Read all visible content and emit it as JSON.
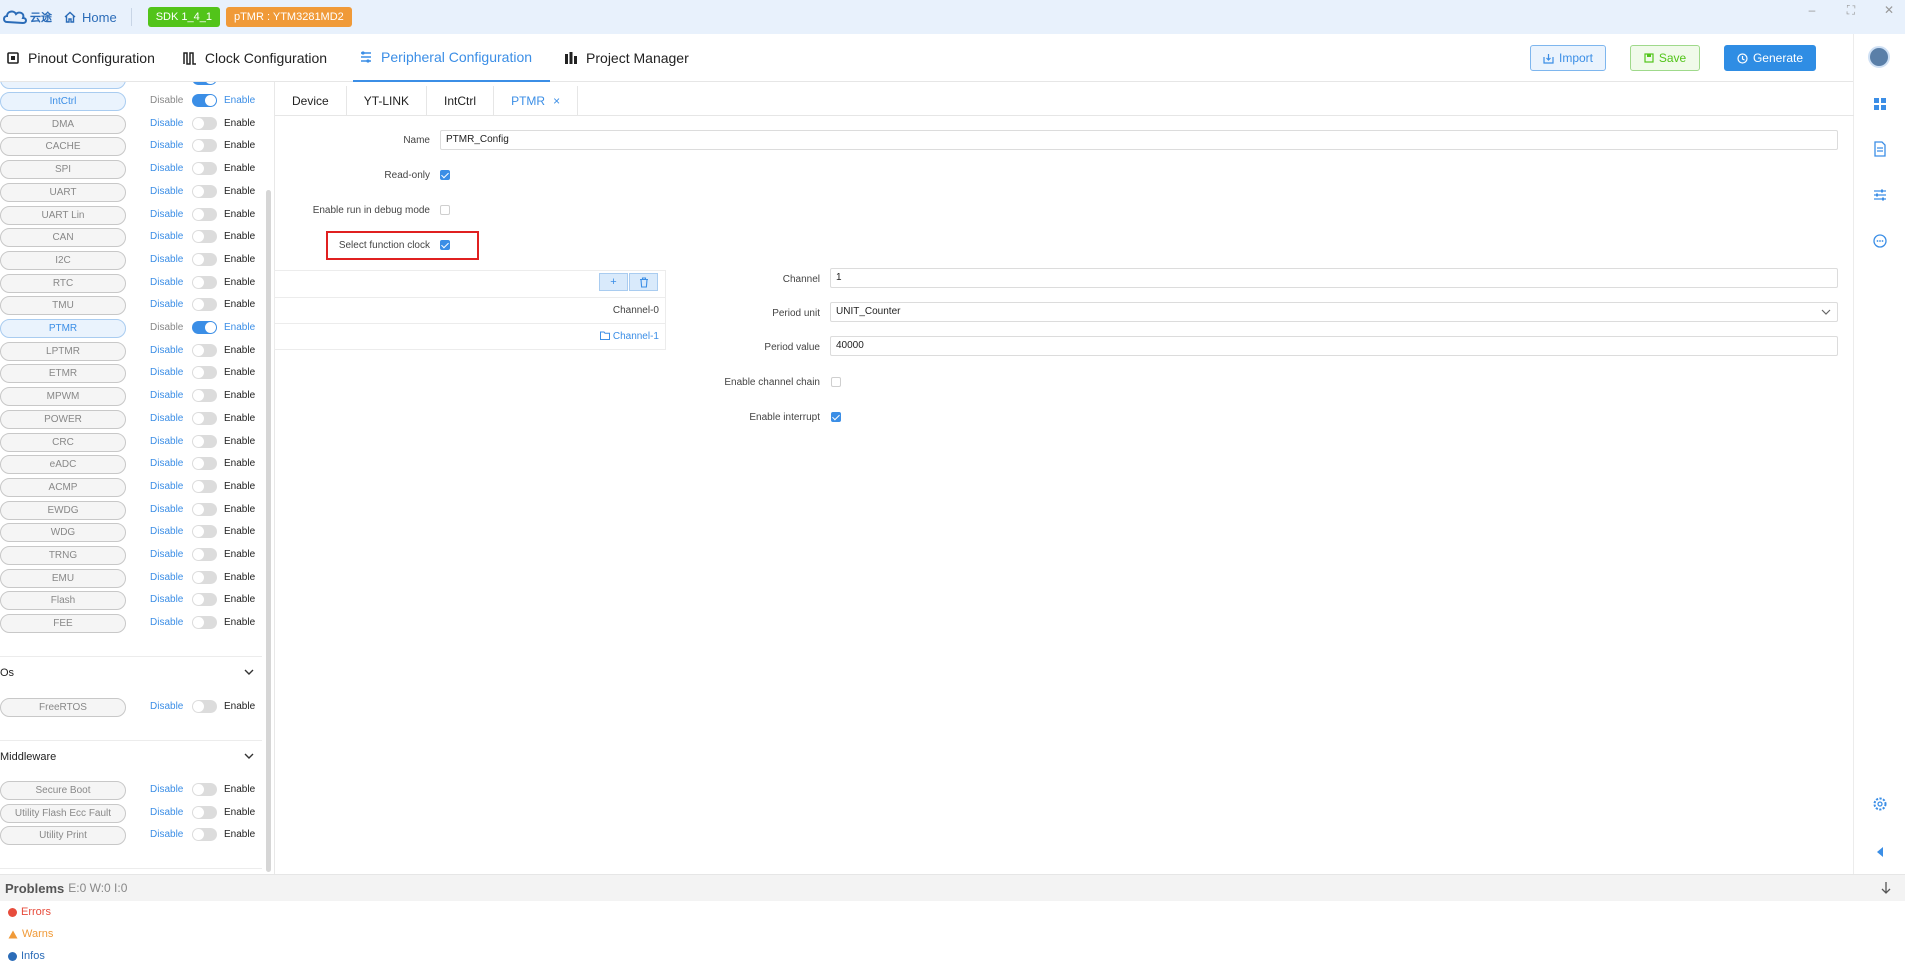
{
  "titlebar": {
    "logo_text": "云途",
    "home_label": "Home",
    "sdk_badge": "SDK 1_4_1",
    "device_badge": "pTMR : YTM3281MD2"
  },
  "nav": {
    "items": [
      {
        "label": "Pinout Configuration"
      },
      {
        "label": "Clock Configuration"
      },
      {
        "label": "Peripheral Configuration"
      },
      {
        "label": "Project Manager"
      }
    ],
    "import_label": "Import",
    "save_label": "Save",
    "generate_label": "Generate"
  },
  "peripherals": [
    {
      "name": "IntCtrl",
      "disable": "Disable",
      "enable": "Enable",
      "enabled": true
    },
    {
      "name": "DMA",
      "disable": "Disable",
      "enable": "Enable",
      "enabled": false
    },
    {
      "name": "CACHE",
      "disable": "Disable",
      "enable": "Enable",
      "enabled": false
    },
    {
      "name": "SPI",
      "disable": "Disable",
      "enable": "Enable",
      "enabled": false
    },
    {
      "name": "UART",
      "disable": "Disable",
      "enable": "Enable",
      "enabled": false
    },
    {
      "name": "UART Lin",
      "disable": "Disable",
      "enable": "Enable",
      "enabled": false
    },
    {
      "name": "CAN",
      "disable": "Disable",
      "enable": "Enable",
      "enabled": false
    },
    {
      "name": "I2C",
      "disable": "Disable",
      "enable": "Enable",
      "enabled": false
    },
    {
      "name": "RTC",
      "disable": "Disable",
      "enable": "Enable",
      "enabled": false
    },
    {
      "name": "TMU",
      "disable": "Disable",
      "enable": "Enable",
      "enabled": false
    },
    {
      "name": "PTMR",
      "disable": "Disable",
      "enable": "Enable",
      "enabled": true
    },
    {
      "name": "LPTMR",
      "disable": "Disable",
      "enable": "Enable",
      "enabled": false
    },
    {
      "name": "ETMR",
      "disable": "Disable",
      "enable": "Enable",
      "enabled": false
    },
    {
      "name": "MPWM",
      "disable": "Disable",
      "enable": "Enable",
      "enabled": false
    },
    {
      "name": "POWER",
      "disable": "Disable",
      "enable": "Enable",
      "enabled": false
    },
    {
      "name": "CRC",
      "disable": "Disable",
      "enable": "Enable",
      "enabled": false
    },
    {
      "name": "eADC",
      "disable": "Disable",
      "enable": "Enable",
      "enabled": false
    },
    {
      "name": "ACMP",
      "disable": "Disable",
      "enable": "Enable",
      "enabled": false
    },
    {
      "name": "EWDG",
      "disable": "Disable",
      "enable": "Enable",
      "enabled": false
    },
    {
      "name": "WDG",
      "disable": "Disable",
      "enable": "Enable",
      "enabled": false
    },
    {
      "name": "TRNG",
      "disable": "Disable",
      "enable": "Enable",
      "enabled": false
    },
    {
      "name": "EMU",
      "disable": "Disable",
      "enable": "Enable",
      "enabled": false
    },
    {
      "name": "Flash",
      "disable": "Disable",
      "enable": "Enable",
      "enabled": false
    },
    {
      "name": "FEE",
      "disable": "Disable",
      "enable": "Enable",
      "enabled": false
    }
  ],
  "os_section": {
    "title": "Os",
    "items": [
      {
        "name": "FreeRTOS",
        "disable": "Disable",
        "enable": "Enable",
        "enabled": false
      }
    ]
  },
  "middleware_section": {
    "title": "Middleware",
    "items": [
      {
        "name": "Secure Boot",
        "disable": "Disable",
        "enable": "Enable",
        "enabled": false
      },
      {
        "name": "Utility Flash Ecc Fault",
        "disable": "Disable",
        "enable": "Enable",
        "enabled": false
      },
      {
        "name": "Utility Print",
        "disable": "Disable",
        "enable": "Enable",
        "enabled": false
      }
    ]
  },
  "tabs": [
    {
      "label": "Device"
    },
    {
      "label": "YT-LINK"
    },
    {
      "label": "IntCtrl"
    },
    {
      "label": "PTMR",
      "close": "×"
    }
  ],
  "form": {
    "name_label": "Name",
    "name_value": "PTMR_Config",
    "readonly_label": "Read-only",
    "readonly_checked": true,
    "debug_label": "Enable run in debug mode",
    "debug_checked": false,
    "funcclock_label": "Select function clock",
    "funcclock_checked": true
  },
  "channels": {
    "add_icon": "+",
    "items": [
      "Channel-0",
      "Channel-1"
    ]
  },
  "channel_form": {
    "channel_label": "Channel",
    "channel_value": "1",
    "period_unit_label": "Period unit",
    "period_unit_value": "UNIT_Counter",
    "period_value_label": "Period value",
    "period_value_value": "40000",
    "chain_label": "Enable channel chain",
    "chain_checked": false,
    "interrupt_label": "Enable interrupt",
    "interrupt_checked": true
  },
  "problems": {
    "title": "Problems",
    "counts": "E:0 W:0 I:0",
    "errors": "Errors",
    "warns": "Warns",
    "infos": "Infos"
  },
  "colors": {
    "accent": "#3b8ee6",
    "sdk_badge": "#52c41a",
    "device_badge": "#f09a38",
    "highlight": "#e02020"
  }
}
